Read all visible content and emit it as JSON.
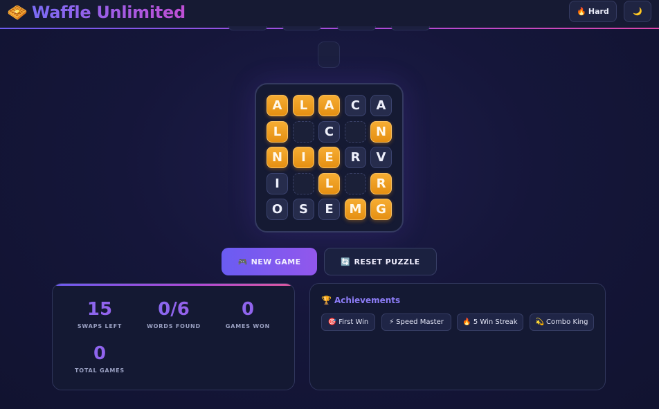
{
  "header": {
    "brand_icon": "🧇",
    "title": "Waffle Unlimited",
    "difficulty_icon": "🔥",
    "difficulty_label": "Hard",
    "theme_icon": "🌙"
  },
  "board": {
    "rows": [
      [
        {
          "letter": "A",
          "state": "gold"
        },
        {
          "letter": "L",
          "state": "gold"
        },
        {
          "letter": "A",
          "state": "gold"
        },
        {
          "letter": "C",
          "state": "plain"
        },
        {
          "letter": "A",
          "state": "plain"
        }
      ],
      [
        {
          "letter": "L",
          "state": "gold"
        },
        {
          "letter": "",
          "state": "hole"
        },
        {
          "letter": "C",
          "state": "plain"
        },
        {
          "letter": "",
          "state": "hole"
        },
        {
          "letter": "N",
          "state": "gold"
        }
      ],
      [
        {
          "letter": "N",
          "state": "gold"
        },
        {
          "letter": "I",
          "state": "gold"
        },
        {
          "letter": "E",
          "state": "gold"
        },
        {
          "letter": "R",
          "state": "plain"
        },
        {
          "letter": "V",
          "state": "plain"
        }
      ],
      [
        {
          "letter": "I",
          "state": "plain"
        },
        {
          "letter": "",
          "state": "hole"
        },
        {
          "letter": "L",
          "state": "gold"
        },
        {
          "letter": "",
          "state": "hole"
        },
        {
          "letter": "R",
          "state": "gold"
        }
      ],
      [
        {
          "letter": "O",
          "state": "plain"
        },
        {
          "letter": "S",
          "state": "plain"
        },
        {
          "letter": "E",
          "state": "plain"
        },
        {
          "letter": "M",
          "state": "gold"
        },
        {
          "letter": "G",
          "state": "gold"
        }
      ]
    ]
  },
  "actions": {
    "new_game_icon": "🎮",
    "new_game_label": "NEW GAME",
    "reset_icon": "🔄",
    "reset_label": "RESET PUZZLE"
  },
  "stats": [
    {
      "value": "15",
      "label": "SWAPS LEFT"
    },
    {
      "value": "0/6",
      "label": "WORDS FOUND"
    },
    {
      "value": "0",
      "label": "GAMES WON"
    },
    {
      "value": "0",
      "label": "TOTAL GAMES"
    }
  ],
  "achievements": {
    "title_icon": "🏆",
    "title": "Achievements",
    "items": [
      {
        "icon": "🎯",
        "label": "First Win"
      },
      {
        "icon": "⚡",
        "label": "Speed Master"
      },
      {
        "icon": "🔥",
        "label": "5 Win Streak"
      },
      {
        "icon": "💫",
        "label": "Combo King"
      }
    ]
  },
  "colors": {
    "accent": "#7b6cf6",
    "tile_gold": "#f0a020",
    "tile_plain": "#262c4c",
    "background": "#15163a"
  }
}
